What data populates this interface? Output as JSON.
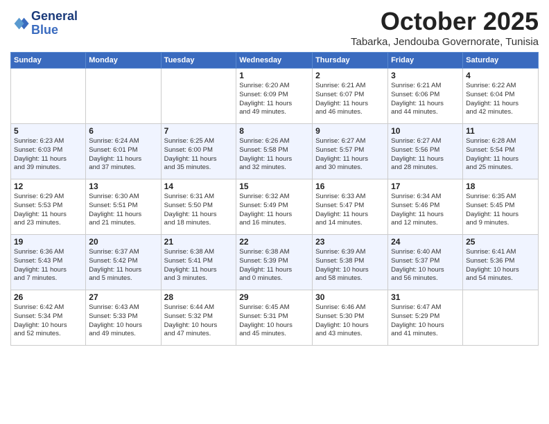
{
  "header": {
    "logo_line1": "General",
    "logo_line2": "Blue",
    "main_title": "October 2025",
    "sub_title": "Tabarka, Jendouba Governorate, Tunisia"
  },
  "days_of_week": [
    "Sunday",
    "Monday",
    "Tuesday",
    "Wednesday",
    "Thursday",
    "Friday",
    "Saturday"
  ],
  "weeks": [
    [
      {
        "day": "",
        "detail": ""
      },
      {
        "day": "",
        "detail": ""
      },
      {
        "day": "",
        "detail": ""
      },
      {
        "day": "1",
        "detail": "Sunrise: 6:20 AM\nSunset: 6:09 PM\nDaylight: 11 hours\nand 49 minutes."
      },
      {
        "day": "2",
        "detail": "Sunrise: 6:21 AM\nSunset: 6:07 PM\nDaylight: 11 hours\nand 46 minutes."
      },
      {
        "day": "3",
        "detail": "Sunrise: 6:21 AM\nSunset: 6:06 PM\nDaylight: 11 hours\nand 44 minutes."
      },
      {
        "day": "4",
        "detail": "Sunrise: 6:22 AM\nSunset: 6:04 PM\nDaylight: 11 hours\nand 42 minutes."
      }
    ],
    [
      {
        "day": "5",
        "detail": "Sunrise: 6:23 AM\nSunset: 6:03 PM\nDaylight: 11 hours\nand 39 minutes."
      },
      {
        "day": "6",
        "detail": "Sunrise: 6:24 AM\nSunset: 6:01 PM\nDaylight: 11 hours\nand 37 minutes."
      },
      {
        "day": "7",
        "detail": "Sunrise: 6:25 AM\nSunset: 6:00 PM\nDaylight: 11 hours\nand 35 minutes."
      },
      {
        "day": "8",
        "detail": "Sunrise: 6:26 AM\nSunset: 5:58 PM\nDaylight: 11 hours\nand 32 minutes."
      },
      {
        "day": "9",
        "detail": "Sunrise: 6:27 AM\nSunset: 5:57 PM\nDaylight: 11 hours\nand 30 minutes."
      },
      {
        "day": "10",
        "detail": "Sunrise: 6:27 AM\nSunset: 5:56 PM\nDaylight: 11 hours\nand 28 minutes."
      },
      {
        "day": "11",
        "detail": "Sunrise: 6:28 AM\nSunset: 5:54 PM\nDaylight: 11 hours\nand 25 minutes."
      }
    ],
    [
      {
        "day": "12",
        "detail": "Sunrise: 6:29 AM\nSunset: 5:53 PM\nDaylight: 11 hours\nand 23 minutes."
      },
      {
        "day": "13",
        "detail": "Sunrise: 6:30 AM\nSunset: 5:51 PM\nDaylight: 11 hours\nand 21 minutes."
      },
      {
        "day": "14",
        "detail": "Sunrise: 6:31 AM\nSunset: 5:50 PM\nDaylight: 11 hours\nand 18 minutes."
      },
      {
        "day": "15",
        "detail": "Sunrise: 6:32 AM\nSunset: 5:49 PM\nDaylight: 11 hours\nand 16 minutes."
      },
      {
        "day": "16",
        "detail": "Sunrise: 6:33 AM\nSunset: 5:47 PM\nDaylight: 11 hours\nand 14 minutes."
      },
      {
        "day": "17",
        "detail": "Sunrise: 6:34 AM\nSunset: 5:46 PM\nDaylight: 11 hours\nand 12 minutes."
      },
      {
        "day": "18",
        "detail": "Sunrise: 6:35 AM\nSunset: 5:45 PM\nDaylight: 11 hours\nand 9 minutes."
      }
    ],
    [
      {
        "day": "19",
        "detail": "Sunrise: 6:36 AM\nSunset: 5:43 PM\nDaylight: 11 hours\nand 7 minutes."
      },
      {
        "day": "20",
        "detail": "Sunrise: 6:37 AM\nSunset: 5:42 PM\nDaylight: 11 hours\nand 5 minutes."
      },
      {
        "day": "21",
        "detail": "Sunrise: 6:38 AM\nSunset: 5:41 PM\nDaylight: 11 hours\nand 3 minutes."
      },
      {
        "day": "22",
        "detail": "Sunrise: 6:38 AM\nSunset: 5:39 PM\nDaylight: 11 hours\nand 0 minutes."
      },
      {
        "day": "23",
        "detail": "Sunrise: 6:39 AM\nSunset: 5:38 PM\nDaylight: 10 hours\nand 58 minutes."
      },
      {
        "day": "24",
        "detail": "Sunrise: 6:40 AM\nSunset: 5:37 PM\nDaylight: 10 hours\nand 56 minutes."
      },
      {
        "day": "25",
        "detail": "Sunrise: 6:41 AM\nSunset: 5:36 PM\nDaylight: 10 hours\nand 54 minutes."
      }
    ],
    [
      {
        "day": "26",
        "detail": "Sunrise: 6:42 AM\nSunset: 5:34 PM\nDaylight: 10 hours\nand 52 minutes."
      },
      {
        "day": "27",
        "detail": "Sunrise: 6:43 AM\nSunset: 5:33 PM\nDaylight: 10 hours\nand 49 minutes."
      },
      {
        "day": "28",
        "detail": "Sunrise: 6:44 AM\nSunset: 5:32 PM\nDaylight: 10 hours\nand 47 minutes."
      },
      {
        "day": "29",
        "detail": "Sunrise: 6:45 AM\nSunset: 5:31 PM\nDaylight: 10 hours\nand 45 minutes."
      },
      {
        "day": "30",
        "detail": "Sunrise: 6:46 AM\nSunset: 5:30 PM\nDaylight: 10 hours\nand 43 minutes."
      },
      {
        "day": "31",
        "detail": "Sunrise: 6:47 AM\nSunset: 5:29 PM\nDaylight: 10 hours\nand 41 minutes."
      },
      {
        "day": "",
        "detail": ""
      }
    ]
  ]
}
